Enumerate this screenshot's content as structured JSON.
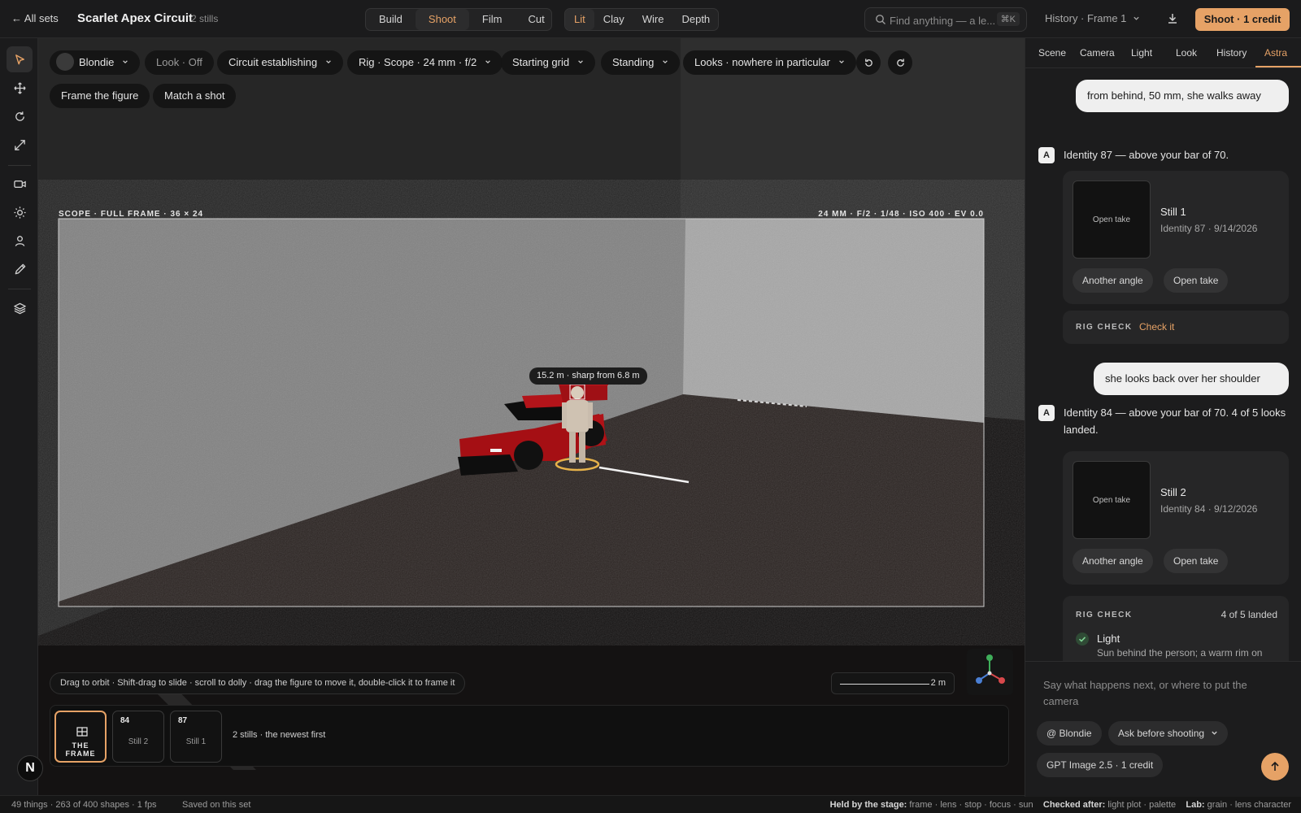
{
  "topbar": {
    "back": "← All sets",
    "title": "Scarlet Apex Circuit",
    "count": "2 stills",
    "modes": [
      "Build",
      "Shoot",
      "Film",
      "Cut"
    ],
    "active_mode": "Shoot",
    "render_modes": [
      "Lit",
      "Clay",
      "Wire",
      "Depth"
    ],
    "active_render": "Lit",
    "search_placeholder": "Find anything — a le...",
    "search_shortcut": "⌘K",
    "history": "History · Frame 1",
    "shoot_button": "Shoot · 1 credit"
  },
  "toolbar_icons": [
    "select-icon",
    "move-icon",
    "rotate-icon",
    "scale-icon",
    "camera-icon",
    "light-icon",
    "person-icon",
    "brush-icon",
    "layers-icon"
  ],
  "viewport": {
    "pills": {
      "character": "Blondie",
      "look": "Look · Off",
      "shot": "Circuit establishing",
      "rig": "Rig · Scope · 24 mm · f/2",
      "place": "Starting grid",
      "pose": "Standing",
      "gaze": "Looks · nowhere in particular",
      "frame_figure": "Frame the figure",
      "match_shot": "Match a shot"
    },
    "frame_left_label": "SCOPE · FULL FRAME · 36 × 24",
    "frame_right_label": "24 MM · F/2 · 1/48 · ISO 400 · EV 0.0",
    "focus_tag": "15.2 m · sharp from 6.8 m",
    "hint": "Drag to orbit · Shift-drag to slide · scroll to dolly · drag the figure to move it, double-click it to frame it",
    "scale": "2 m",
    "timeline": {
      "frame_label": "THE FRAME",
      "stills": [
        {
          "num": "84",
          "label": "Still 2"
        },
        {
          "num": "87",
          "label": "Still 1"
        }
      ],
      "count": "2 stills · the newest first"
    },
    "badge": "N"
  },
  "status": {
    "left": "49 things · 263 of 400 shapes · 1 fps",
    "saved": "Saved on this set",
    "held_label": "Held by the stage:",
    "held": "frame · lens · stop · focus · sun",
    "checked_label": "Checked after:",
    "checked": "light plot · palette",
    "lab_label": "Lab:",
    "lab": "grain · lens character"
  },
  "panel": {
    "tabs": [
      "Scene",
      "Camera",
      "Light",
      "Look",
      "History",
      "Astra"
    ],
    "active_tab": "Astra",
    "messages": {
      "user1": "from behind, 50 mm, she walks away",
      "bot1": "Identity 87 — above your bar of 70.",
      "still1": {
        "box": "Open take",
        "title": "Still 1",
        "meta": "Identity 87 · 9/14/2026"
      },
      "user2": "she looks back over her shoulder",
      "bot2": "Identity 84 — above your bar of 70. 4 of 5 looks landed.",
      "still2": {
        "box": "Open take",
        "title": "Still 2",
        "meta": "Identity 84 · 9/12/2026"
      },
      "another_angle": "Another angle",
      "open_take": "Open take",
      "rig_check_label": "RIG CHECK",
      "check_it": "Check it",
      "rig_count": "4 of 5 landed",
      "check_item_title": "Light",
      "check_item_desc": "Sun behind the person; a warm rim on"
    },
    "composer": {
      "placeholder": "Say what happens next, or where to put the camera",
      "mention": "@ Blondie",
      "ask": "Ask before shooting",
      "model": "GPT Image 2.5 · 1 credit"
    }
  },
  "colors": {
    "accent": "#e6a266",
    "car": "#b01217",
    "floor": "#2a2321"
  }
}
